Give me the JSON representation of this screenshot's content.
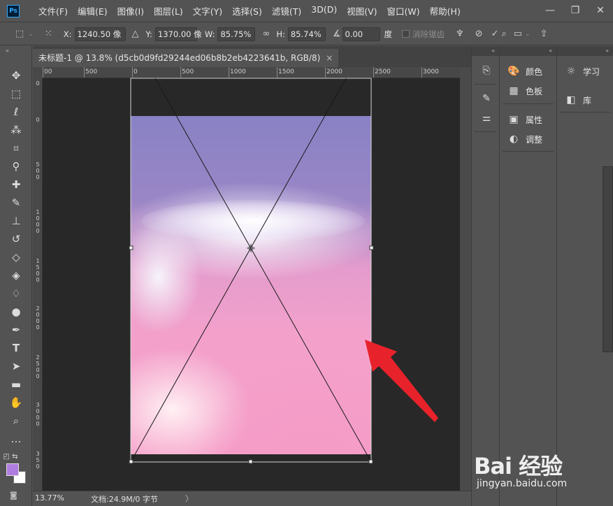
{
  "menubar": {
    "app_logo": "Ps",
    "items": [
      "文件(F)",
      "编辑(E)",
      "图像(I)",
      "图层(L)",
      "文字(Y)",
      "选择(S)",
      "滤镜(T)",
      "3D(D)",
      "视图(V)",
      "窗口(W)",
      "帮助(H)"
    ],
    "window_controls": [
      "minimize-icon",
      "restore-icon",
      "close-icon"
    ]
  },
  "options": {
    "x_label": "X:",
    "x_value": "1240.50 像",
    "y_label": "Y:",
    "y_value": "1370.00 像",
    "w_label": "W:",
    "w_value": "85.75%",
    "h_label": "H:",
    "h_value": "85.74%",
    "angle_value": "0.00",
    "angle_unit": "度",
    "interp_label": "消除锯齿"
  },
  "tools": [
    "move-icon",
    "marquee-icon",
    "lasso-icon",
    "magic-wand-icon",
    "crop-icon",
    "eyedropper-icon",
    "healing-brush-icon",
    "brush-icon",
    "clone-stamp-icon",
    "history-brush-icon",
    "eraser-icon",
    "paint-bucket-icon",
    "blur-icon",
    "dodge-icon",
    "pen-icon",
    "type-icon",
    "path-selection-icon",
    "rectangle-icon",
    "hand-icon",
    "zoom-icon",
    "more-tools-icon"
  ],
  "colors": {
    "foreground": "#b07ee0",
    "background": "#ffffff"
  },
  "document": {
    "tab_title": "未标题-1 @ 13.8% (d5cb0d9fd29244ed06b8b2eb4223641b, RGB/8)",
    "close": "×"
  },
  "rulers": {
    "h_ticks": [
      "00",
      "500",
      "0",
      "500",
      "1000",
      "1500",
      "2000",
      "2500",
      "3000"
    ],
    "v_ticks": [
      "0",
      "0",
      "5",
      "0",
      "0",
      "1",
      "0",
      "0",
      "0",
      "1",
      "5",
      "0",
      "0",
      "2",
      "0",
      "0",
      "0",
      "2",
      "5",
      "0",
      "0",
      "3",
      "0",
      "0",
      "0",
      "3",
      "5",
      "0"
    ]
  },
  "status": {
    "zoom": "13.77%",
    "doc_info": "文档:24.9M/0 字节",
    "arrow": "〉"
  },
  "panels": {
    "group1": [
      {
        "icon": "palette-icon",
        "label": "颜色"
      },
      {
        "icon": "swatches-icon",
        "label": "色板"
      }
    ],
    "group2": [
      {
        "icon": "properties-icon",
        "label": "属性"
      },
      {
        "icon": "adjustments-icon",
        "label": "调整"
      }
    ],
    "group3": [
      {
        "icon": "learn-icon",
        "label": "学习"
      },
      {
        "icon": "libraries-icon",
        "label": "库"
      }
    ]
  },
  "watermark": {
    "logo": "Bai 经验",
    "url": "jingyan.baidu.com"
  }
}
